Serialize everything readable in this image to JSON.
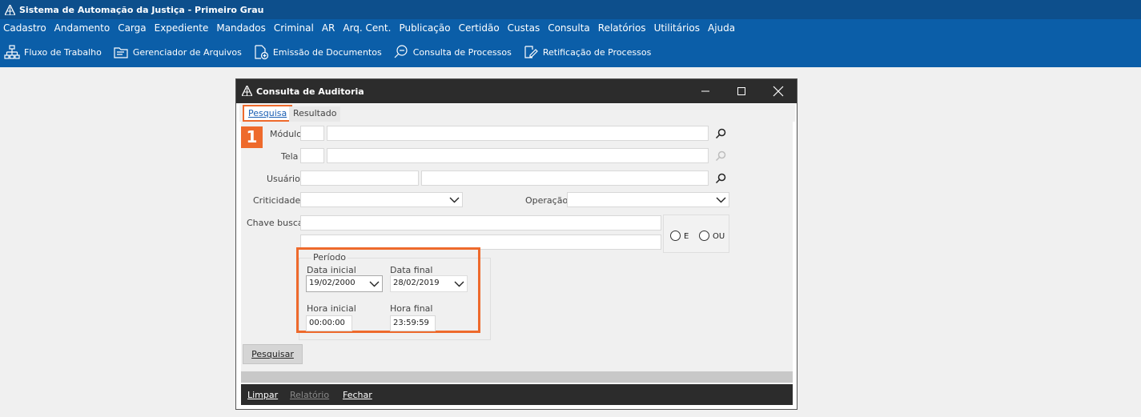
{
  "app": {
    "title": "Sistema de Automação da Justiça - Primeiro Grau",
    "logo_icon": "saj-logo-icon"
  },
  "menu": [
    "Cadastro",
    "Andamento",
    "Carga",
    "Expediente",
    "Mandados",
    "Criminal",
    "AR",
    "Arq. Cent.",
    "Publicação",
    "Certidão",
    "Custas",
    "Consulta",
    "Relatórios",
    "Utilitários",
    "Ajuda"
  ],
  "toolbar": [
    {
      "label": "Fluxo de Trabalho",
      "icon": "workflow-icon"
    },
    {
      "label": "Gerenciador de Arquivos",
      "icon": "folder-icon"
    },
    {
      "label": "Emissão de Documentos",
      "icon": "document-add-icon"
    },
    {
      "label": "Consulta de Processos",
      "icon": "search-document-icon"
    },
    {
      "label": "Retificação de Processos",
      "icon": "edit-document-icon"
    }
  ],
  "dialog": {
    "title": "Consulta de Auditoria",
    "tabs": {
      "pesquisa": "Pesquisa",
      "resultado": "Resultado",
      "active": "Pesquisa"
    },
    "step_badge": "1",
    "labels": {
      "modulo": "Módulo",
      "tela": "Tela",
      "usuario": "Usuário",
      "criticidade": "Criticidade",
      "operacao": "Operação",
      "chave_busca": "Chave busca"
    },
    "values": {
      "modulo_code": "",
      "modulo_desc": "",
      "tela_code": "",
      "tela_desc": "",
      "usuario_code": "",
      "usuario_desc": "",
      "criticidade": "",
      "operacao": "",
      "chave_busca_1": "",
      "chave_busca_2": ""
    },
    "radio": {
      "e": "E",
      "ou": "OU"
    },
    "periodo": {
      "legend": "Período",
      "data_inicial_label": "Data inicial",
      "data_inicial": "19/02/2000",
      "data_final_label": "Data final",
      "data_final": "28/02/2019",
      "hora_inicial_label": "Hora inicial",
      "hora_inicial": "00:00:00",
      "hora_final_label": "Hora final",
      "hora_final": "23:59:59"
    },
    "pesquisar_button": "Pesquisar",
    "footer": {
      "limpar": "Limpar",
      "relatorio": "Relatório",
      "fechar": "Fechar"
    }
  },
  "colors": {
    "titlebar": "#0d4f8c",
    "menubar": "#0b5ea8",
    "highlight": "#ee6a2c",
    "dialog_titlebar": "#2c2c2c"
  }
}
